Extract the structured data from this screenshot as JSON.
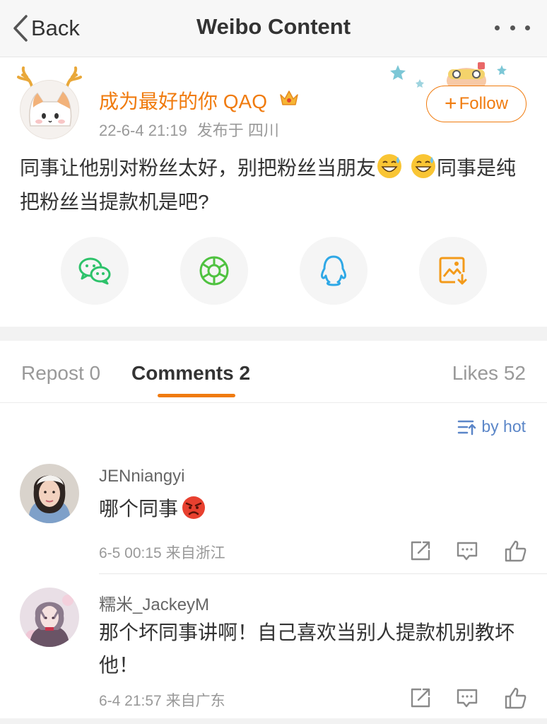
{
  "nav": {
    "back_label": "Back",
    "title": "Weibo Content",
    "more_icon": "more-dots-icon"
  },
  "post": {
    "author": "成为最好的你 QAQ",
    "date": "22-6-4 21:19",
    "source": "发布于 四川",
    "follow_label": "Follow",
    "content_part1": "同事让他别对粉丝太好，别把粉丝当朋友",
    "content_part2": "同事是纯把粉丝当提款机是吧?",
    "share": [
      {
        "icon": "wechat-icon",
        "color": "#2dc26a"
      },
      {
        "icon": "moments-icon",
        "color": "#4fc240"
      },
      {
        "icon": "qq-icon",
        "color": "#2fa8e6"
      },
      {
        "icon": "save-image-icon",
        "color": "#f39a1a"
      }
    ]
  },
  "tabs": {
    "repost_label": "Repost",
    "repost_count": "0",
    "comments_label": "Comments",
    "comments_count": "2",
    "likes_label": "Likes",
    "likes_count": "52"
  },
  "sort": {
    "label": "by hot"
  },
  "comments": [
    {
      "name": "JENniangyi",
      "text": "哪个同事",
      "time": "6-5 00:15",
      "location": "来自浙江"
    },
    {
      "name": "糯米_JackeyM",
      "text": "那个坏同事讲啊！自己喜欢当别人提款机别教坏他！",
      "time": "6-4 21:57",
      "location": "来自广东"
    }
  ],
  "colors": {
    "accent": "#f07b0e",
    "link_blue": "#5b86c8"
  }
}
